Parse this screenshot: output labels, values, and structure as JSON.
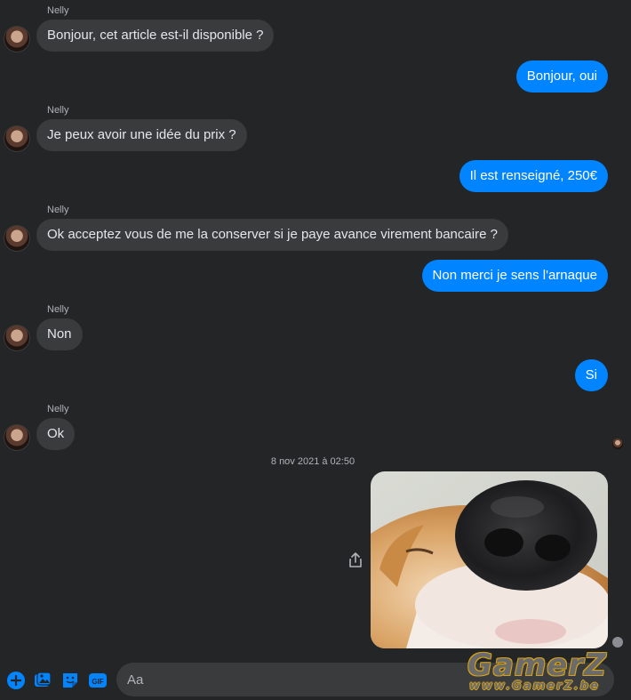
{
  "conversation": {
    "messages": [
      {
        "sender": "Nelly",
        "text": "Bonjour, cet article est-il disponible ?"
      },
      {
        "sender": "me",
        "text": "Bonjour, oui"
      },
      {
        "sender": "Nelly",
        "text": "Je peux avoir une idée du prix ?"
      },
      {
        "sender": "me",
        "text": "Il est renseigné, 250€"
      },
      {
        "sender": "Nelly",
        "text": "Ok acceptez vous de me la conserver si je paye avance virement bancaire ?"
      },
      {
        "sender": "me",
        "text": "Non merci je sens l'arnaque"
      },
      {
        "sender": "Nelly",
        "text": "Non"
      },
      {
        "sender": "me",
        "text": "Si"
      },
      {
        "sender": "Nelly",
        "text": "Ok"
      }
    ],
    "timestamp": "8 nov 2021 à 02:50"
  },
  "composer": {
    "placeholder": "Aa",
    "icons": [
      "plus-circle-icon",
      "image-icon",
      "sticker-icon",
      "gif-icon"
    ],
    "accent": "#0084ff"
  },
  "watermark": {
    "logo": "GamerZ",
    "url": "www.GamerZ.be"
  },
  "colors": {
    "background": "#242526",
    "incoming_bubble": "#3a3b3c",
    "outgoing_bubble": "#0084ff"
  }
}
